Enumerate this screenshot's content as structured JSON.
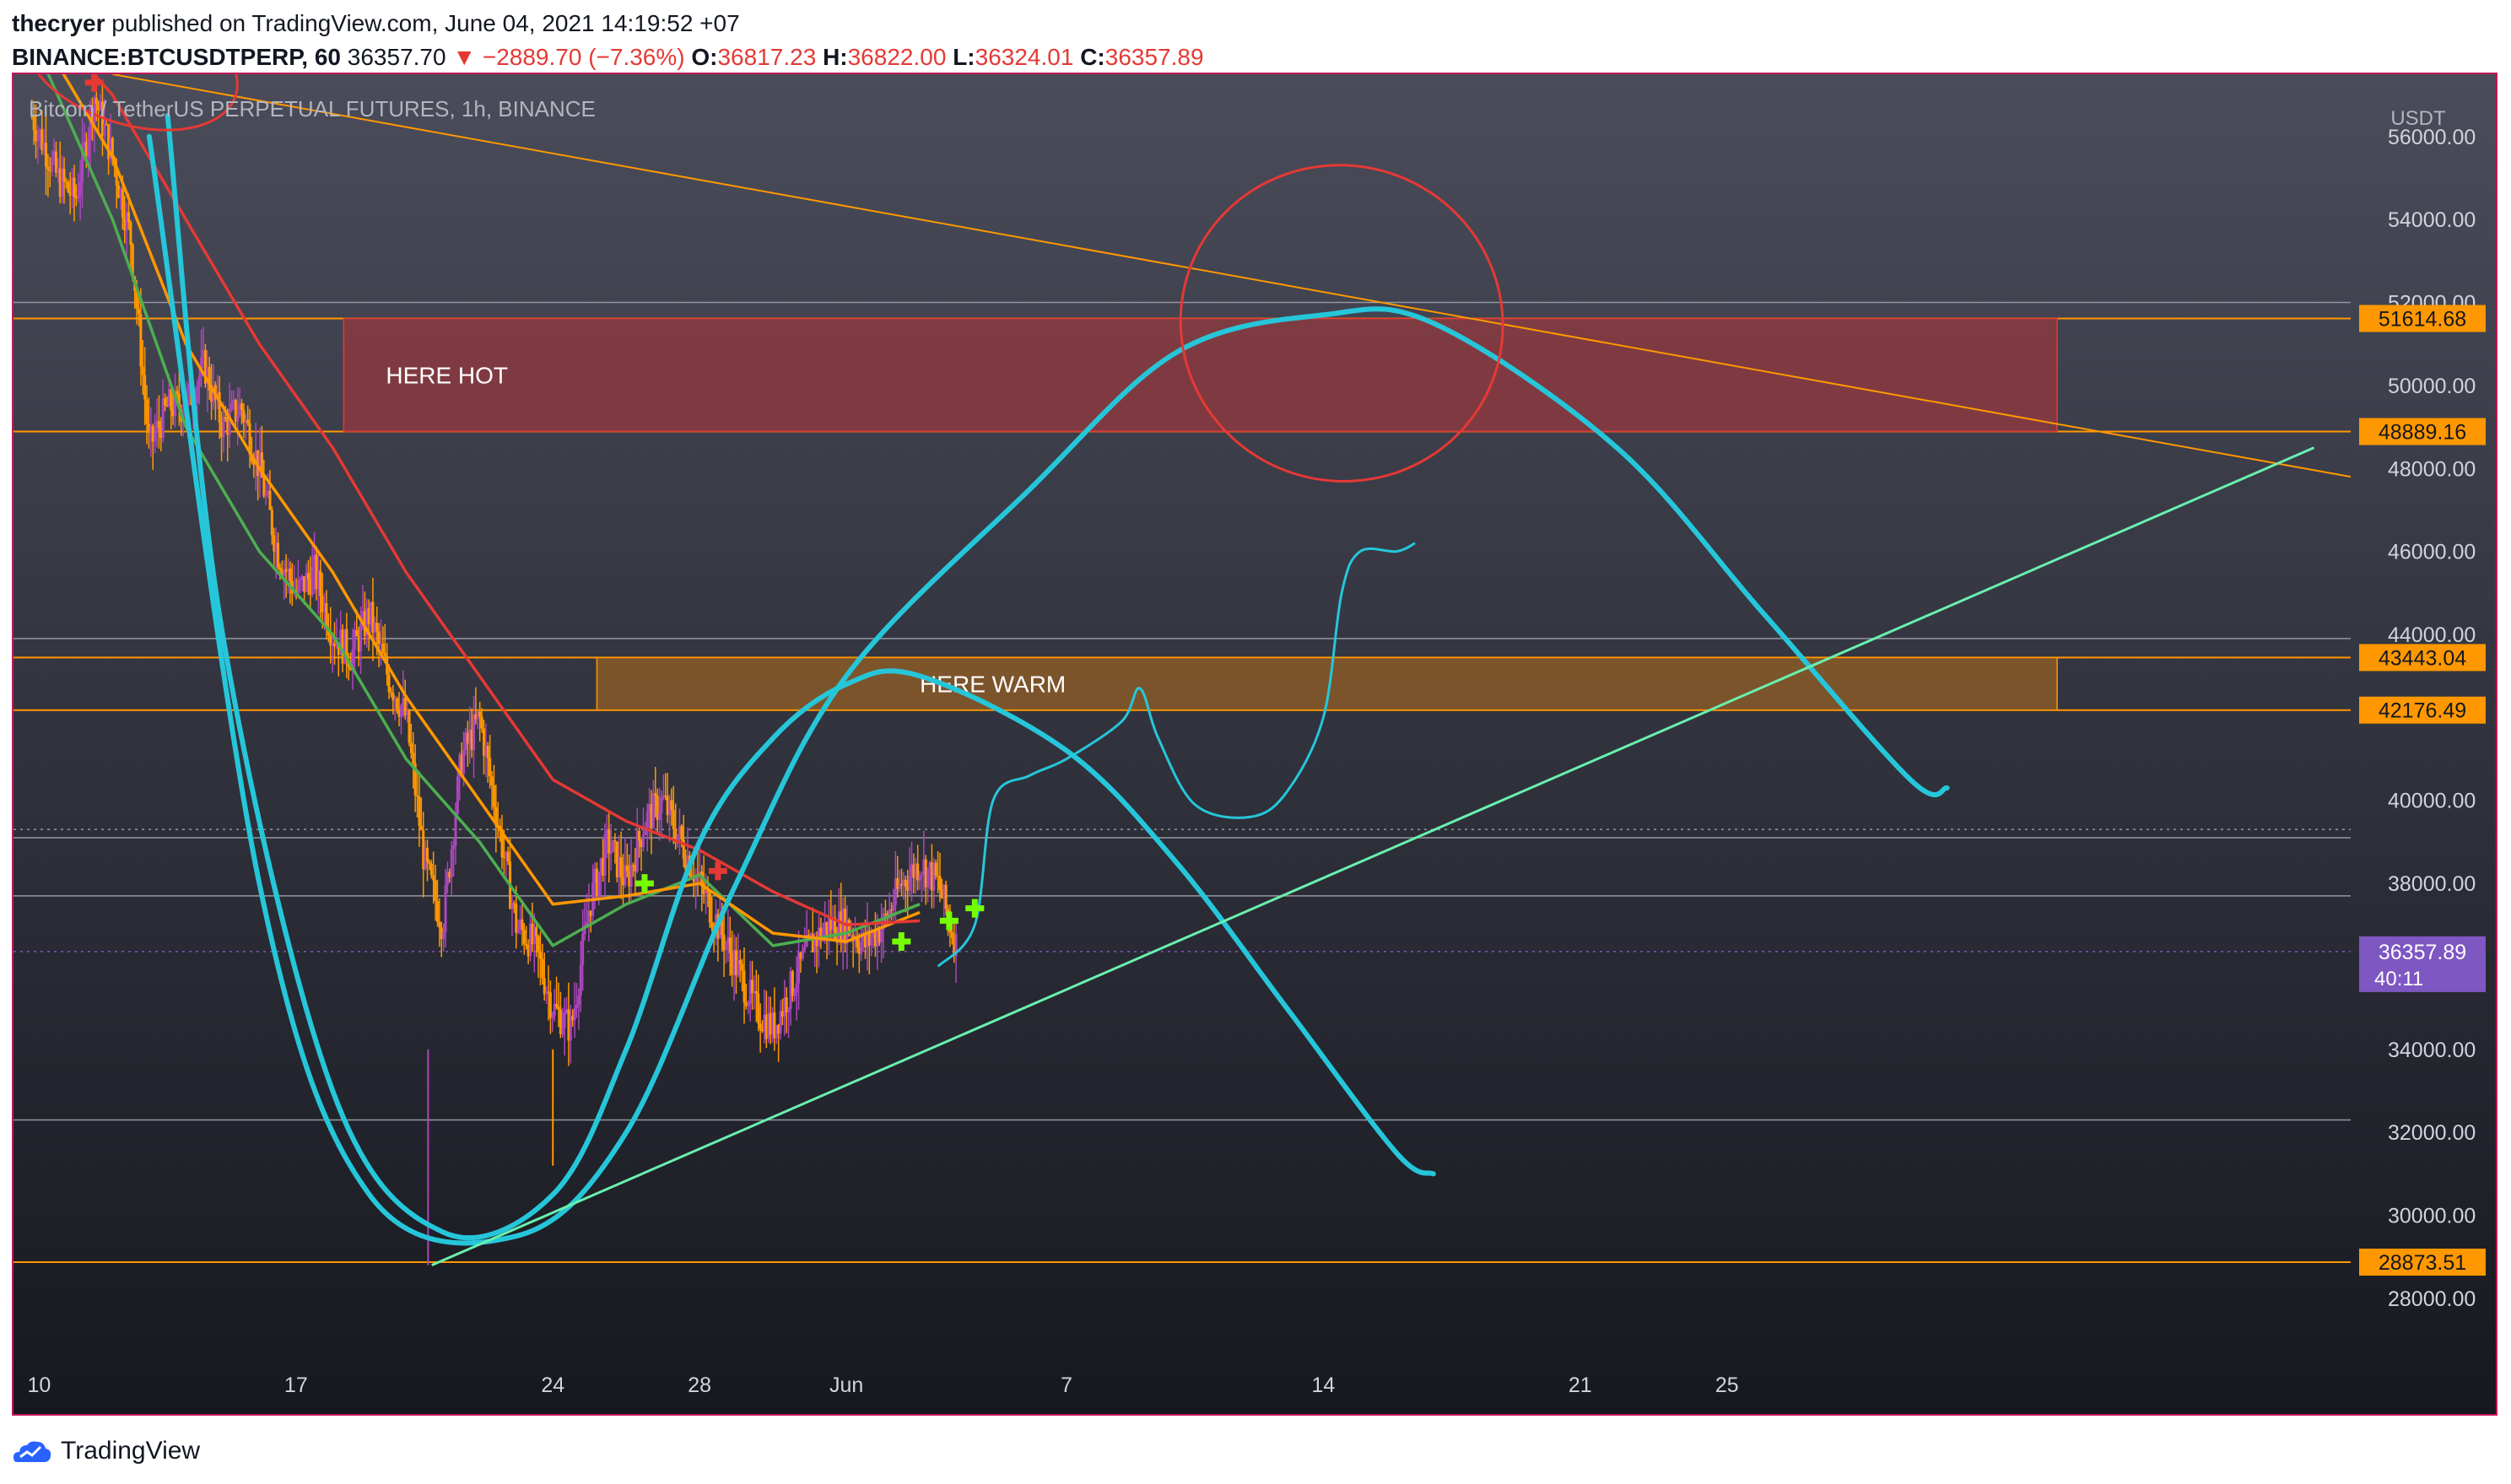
{
  "header": {
    "author": "thecryer",
    "published_text": "published on TradingView.com, June 04, 2021 14:19:52 +07",
    "symbol": "BINANCE:BTCUSDTPERP, 60",
    "last_price": "36357.70",
    "change": "▼ −2889.70 (−7.36%)",
    "open_label": "O:",
    "open_value": "36817.23",
    "high_label": "H:",
    "high_value": "36822.00",
    "low_label": "L:",
    "low_value": "36324.01",
    "close_label": "C:",
    "close_value": "36357.89"
  },
  "chart_data": {
    "type": "candlestick",
    "title": "Bitcoin / TetherUS PERPETUAL FUTURES, 1h, BINANCE",
    "currency": "USDT",
    "y_ticks": [
      28000,
      30000,
      32000,
      34000,
      36000,
      38000,
      40000,
      44000,
      46000,
      48000,
      50000,
      52000,
      54000,
      56000
    ],
    "y_tick_labels": [
      "28000.00",
      "30000.00",
      "32000.00",
      "34000.00",
      "36000.00",
      "38000.00",
      "40000.00",
      "44000.00",
      "46000.00",
      "48000.00",
      "50000.00",
      "52000.00",
      "54000.00",
      "56000.00"
    ],
    "ylim": [
      26800,
      57500
    ],
    "x_ticks": [
      {
        "label": "10",
        "day": 10
      },
      {
        "label": "17",
        "day": 17
      },
      {
        "label": "24",
        "day": 24
      },
      {
        "label": "28",
        "day": 28
      },
      {
        "label": "Jun",
        "day": 32
      },
      {
        "label": "7",
        "day": 38
      },
      {
        "label": "14",
        "day": 45
      },
      {
        "label": "21",
        "day": 52
      },
      {
        "label": "25",
        "day": 56
      }
    ],
    "xlim_days": [
      9.3,
      73
    ],
    "price_path": [
      [
        9.8,
        56500
      ],
      [
        10.5,
        55000
      ],
      [
        11,
        54500
      ],
      [
        11.5,
        57000
      ],
      [
        12,
        55500
      ],
      [
        12.5,
        53500
      ],
      [
        13,
        48500
      ],
      [
        13.5,
        49500
      ],
      [
        14,
        49500
      ],
      [
        14.5,
        50500
      ],
      [
        15,
        49000
      ],
      [
        15.5,
        49500
      ],
      [
        16,
        48000
      ],
      [
        16.5,
        46000
      ],
      [
        17,
        45000
      ],
      [
        17.5,
        45500
      ],
      [
        18,
        44000
      ],
      [
        18.5,
        43500
      ],
      [
        19,
        44500
      ],
      [
        19.5,
        43000
      ],
      [
        20,
        42000
      ],
      [
        20.5,
        38500
      ],
      [
        21,
        37000
      ],
      [
        21.5,
        41000
      ],
      [
        22,
        42000
      ],
      [
        22.5,
        39500
      ],
      [
        23,
        37000
      ],
      [
        23.5,
        36500
      ],
      [
        24,
        35000
      ],
      [
        24.5,
        34500
      ],
      [
        25,
        37500
      ],
      [
        25.5,
        39000
      ],
      [
        26,
        38000
      ],
      [
        26.5,
        39500
      ],
      [
        27,
        40000
      ],
      [
        27.5,
        39000
      ],
      [
        28,
        38000
      ],
      [
        28.5,
        37000
      ],
      [
        29,
        36000
      ],
      [
        29.5,
        35000
      ],
      [
        30,
        34500
      ],
      [
        30.5,
        35500
      ],
      [
        31,
        36500
      ],
      [
        31.5,
        37000
      ],
      [
        32,
        37000
      ],
      [
        32.5,
        36500
      ],
      [
        33,
        37000
      ],
      [
        33.5,
        38000
      ],
      [
        34,
        38500
      ],
      [
        34.5,
        38000
      ],
      [
        35,
        36500
      ]
    ],
    "moving_averages": [
      {
        "color": "#4caf50",
        "points": [
          [
            10,
            58000
          ],
          [
            12,
            54000
          ],
          [
            14,
            49000
          ],
          [
            16,
            46000
          ],
          [
            18,
            44000
          ],
          [
            20,
            41000
          ],
          [
            22,
            39000
          ],
          [
            24,
            36500
          ],
          [
            26,
            37500
          ],
          [
            28,
            38200
          ],
          [
            30,
            36500
          ],
          [
            32,
            36800
          ],
          [
            34,
            37500
          ]
        ]
      },
      {
        "color": "#ff9800",
        "points": [
          [
            10,
            58500
          ],
          [
            12,
            55500
          ],
          [
            14,
            51000
          ],
          [
            16,
            48000
          ],
          [
            18,
            45500
          ],
          [
            20,
            42500
          ],
          [
            22,
            40000
          ],
          [
            24,
            37500
          ],
          [
            26,
            37700
          ],
          [
            28,
            38000
          ],
          [
            30,
            36800
          ],
          [
            32,
            36600
          ],
          [
            34,
            37300
          ]
        ]
      },
      {
        "color": "#e53935",
        "points": [
          [
            10,
            59000
          ],
          [
            12,
            57000
          ],
          [
            14,
            54000
          ],
          [
            16,
            51000
          ],
          [
            18,
            48500
          ],
          [
            20,
            45500
          ],
          [
            22,
            43000
          ],
          [
            24,
            40500
          ],
          [
            26,
            39500
          ],
          [
            28,
            38800
          ],
          [
            30,
            37800
          ],
          [
            32,
            37000
          ],
          [
            34,
            37100
          ]
        ]
      }
    ],
    "price_lines": [
      {
        "value": 51614.68,
        "label": "51614.68",
        "color": "#ff9800"
      },
      {
        "value": 48889.16,
        "label": "48889.16",
        "color": "#ff9800"
      },
      {
        "value": 43443.04,
        "label": "43443.04",
        "color": "#ff9800"
      },
      {
        "value": 42176.49,
        "label": "42176.49",
        "color": "#ff9800"
      },
      {
        "value": 28873.51,
        "label": "28873.51",
        "color": "#ff9800"
      }
    ],
    "gray_lines": [
      52000,
      43900,
      39100,
      37700,
      32300
    ],
    "current_price": {
      "label": "36357.89",
      "countdown": "40:11",
      "value": 36357.89,
      "color": "#7e57c2"
    },
    "zones": [
      {
        "label": "HERE HOT",
        "top": 51614.68,
        "bottom": 48889.16,
        "day_start": 18.3,
        "day_end": 65,
        "color": "#8b3a3f"
      },
      {
        "label": "HERE WARM",
        "top": 43443.04,
        "bottom": 42176.49,
        "day_start": 25.2,
        "day_end": 65,
        "color": "#8a5a28"
      }
    ],
    "trendlines": [
      {
        "color": "#ff9800",
        "from": [
          12,
          57500
        ],
        "to": [
          73,
          47800
        ]
      },
      {
        "color": "#69f0ae",
        "from": [
          20.7,
          28800
        ],
        "to": [
          72,
          48500
        ]
      }
    ],
    "projection": [
      [
        34.5,
        36000
      ],
      [
        35.5,
        37000
      ],
      [
        36,
        40000
      ],
      [
        37,
        40600
      ],
      [
        38,
        41000
      ],
      [
        39.5,
        41900
      ],
      [
        40,
        42700
      ],
      [
        40.5,
        41500
      ],
      [
        41.5,
        39900
      ],
      [
        43,
        39600
      ],
      [
        44,
        40200
      ],
      [
        45,
        42000
      ],
      [
        45.5,
        45000
      ],
      [
        46,
        46000
      ],
      [
        47,
        46000
      ],
      [
        47.5,
        46200
      ]
    ],
    "cyan_curves": [
      {
        "color": "#26c6da",
        "d_days": [
          [
            13,
            56000
          ],
          [
            16,
            38000
          ],
          [
            19,
            30500
          ],
          [
            23,
            29500
          ],
          [
            26,
            32000
          ],
          [
            29,
            38000
          ],
          [
            32,
            43000
          ],
          [
            37,
            47500
          ],
          [
            41,
            50800
          ],
          [
            45,
            51700
          ],
          [
            48,
            51500
          ],
          [
            53,
            48500
          ],
          [
            57,
            44500
          ],
          [
            61,
            40500
          ],
          [
            62,
            40300
          ]
        ]
      },
      {
        "color": "#26c6da",
        "d_days": [
          [
            13.5,
            56500
          ],
          [
            15,
            44000
          ],
          [
            18,
            33000
          ],
          [
            21,
            29600
          ],
          [
            24,
            30500
          ],
          [
            26,
            34000
          ],
          [
            28,
            39000
          ],
          [
            30,
            41500
          ],
          [
            32,
            42800
          ],
          [
            34,
            43000
          ],
          [
            38,
            41200
          ],
          [
            41,
            38500
          ],
          [
            44,
            35000
          ],
          [
            47,
            31500
          ],
          [
            48,
            31000
          ]
        ]
      }
    ],
    "circles": [
      {
        "cx_day": 45.5,
        "cy": 51500,
        "rx_days": 4.4,
        "ry_value": 3800,
        "color": "#e53935"
      },
      {
        "cx_day": 12.5,
        "cy": 57800,
        "rx_days": 3,
        "ry_value": 1500,
        "color": "#e53935"
      }
    ],
    "signal_markers": [
      {
        "day": 26.5,
        "value": 38000,
        "color": "#76ff03"
      },
      {
        "day": 33.5,
        "value": 36600,
        "color": "#76ff03"
      },
      {
        "day": 34.8,
        "value": 37100,
        "color": "#76ff03"
      },
      {
        "day": 35.5,
        "value": 37400,
        "color": "#76ff03"
      },
      {
        "day": 28.5,
        "value": 38300,
        "color": "#e53935"
      },
      {
        "day": 11.5,
        "value": 57300,
        "color": "#e53935"
      }
    ]
  },
  "footer": {
    "brand": "TradingView",
    "logo_icon": "tradingview-cloud-icon"
  }
}
